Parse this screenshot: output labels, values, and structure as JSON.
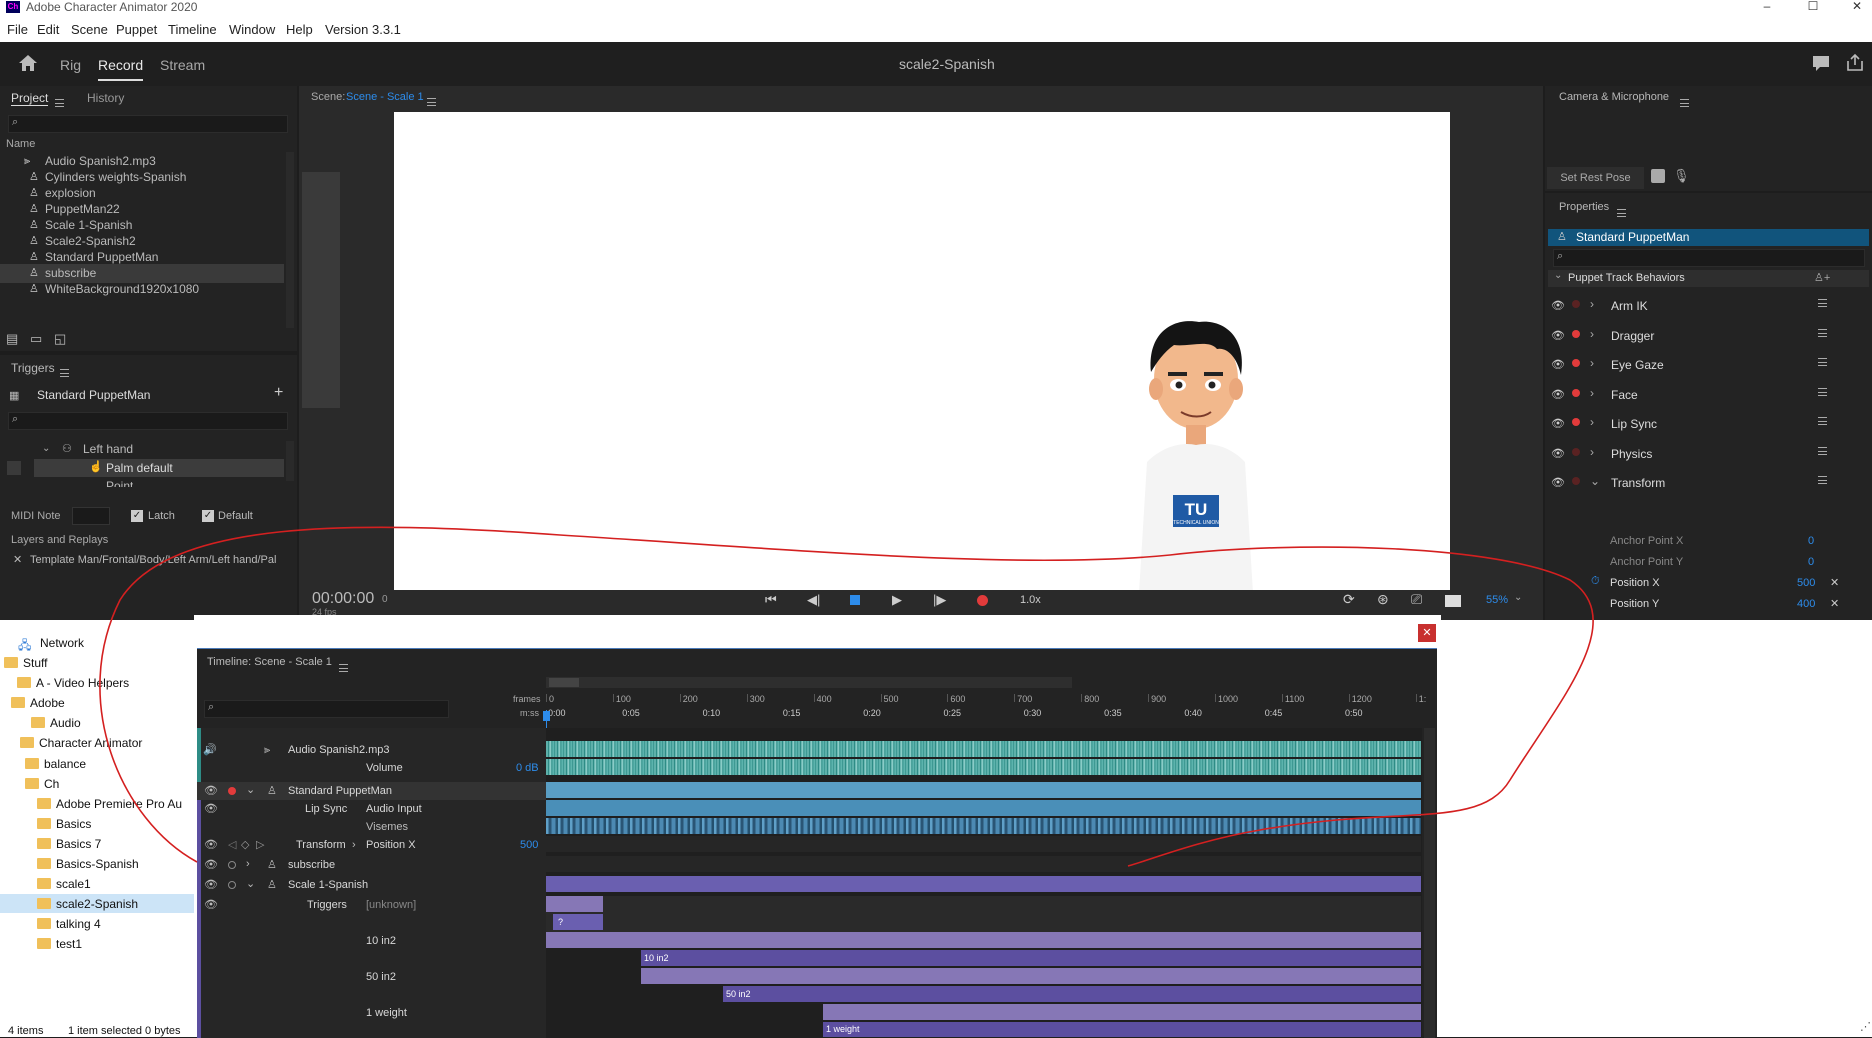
{
  "window": {
    "title": "Adobe Character Animator 2020",
    "logo_text": "Ch"
  },
  "menu": [
    "File",
    "Edit",
    "Scene",
    "Puppet",
    "Timeline",
    "Window",
    "Help",
    "Version 3.3.1"
  ],
  "appbar": {
    "tabs": [
      "Rig",
      "Record",
      "Stream"
    ],
    "active_tab": "Record",
    "doc_title": "scale2-Spanish"
  },
  "project": {
    "tabs": [
      "Project",
      "History"
    ],
    "col_header": "Name",
    "items": [
      {
        "icon": "audio-icon",
        "name": "Audio Spanish2.mp3"
      },
      {
        "icon": "puppet-icon",
        "name": "Cylinders weights-Spanish"
      },
      {
        "icon": "puppet-icon",
        "name": "explosion"
      },
      {
        "icon": "puppet-icon",
        "name": "PuppetMan22"
      },
      {
        "icon": "puppet-icon",
        "name": "Scale 1-Spanish"
      },
      {
        "icon": "puppet-icon",
        "name": "Scale2-Spanish2"
      },
      {
        "icon": "puppet-icon",
        "name": "Standard PuppetMan"
      },
      {
        "icon": "puppet-icon",
        "name": "subscribe"
      },
      {
        "icon": "puppet-icon",
        "name": "WhiteBackground1920x1080"
      }
    ],
    "selected_index": 7
  },
  "triggers": {
    "title": "Triggers",
    "puppet": "Standard PuppetMan",
    "tree": [
      "Left hand",
      "Palm default",
      "Point"
    ],
    "midi_label": "MIDI Note",
    "latch_label": "Latch",
    "default_label": "Default",
    "layers_label": "Layers and Replays",
    "layer_path": "Template Man/Frontal/Body/Left Arm/Left hand/Pal"
  },
  "scene": {
    "label": "Scene:",
    "name": "Scene - Scale 1",
    "timecode": "00:00:00",
    "frame": "0",
    "fps": "24 fps",
    "speed": "1.0x",
    "zoom": "55%",
    "shirt_text": "TU",
    "shirt_sub": "TECHNICAL UNION"
  },
  "camera": {
    "title": "Camera & Microphone",
    "rest_pose": "Set Rest Pose"
  },
  "properties": {
    "title": "Properties",
    "selected": "Standard PuppetMan",
    "section": "Puppet Track Behaviors",
    "behaviors": [
      {
        "name": "Arm IK",
        "armed": false
      },
      {
        "name": "Dragger",
        "armed": true
      },
      {
        "name": "Eye Gaze",
        "armed": true
      },
      {
        "name": "Face",
        "armed": true
      },
      {
        "name": "Lip Sync",
        "armed": true
      },
      {
        "name": "Physics",
        "armed": false
      },
      {
        "name": "Transform",
        "armed": false
      }
    ],
    "params": [
      {
        "name": "Anchor Point X",
        "value": "0"
      },
      {
        "name": "Anchor Point Y",
        "value": "0"
      },
      {
        "name": "Position X",
        "value": "500"
      },
      {
        "name": "Position Y",
        "value": "400"
      }
    ]
  },
  "explorer": {
    "network": "Network",
    "folders": [
      "Stuff",
      "A - Video Helpers",
      "Adobe",
      "Audio",
      "Character Animator",
      "balance",
      "Ch",
      "Adobe Premiere Pro Au",
      "Basics",
      "Basics 7",
      "Basics-Spanish",
      "scale1",
      "scale2-Spanish",
      "talking 4",
      "test1"
    ],
    "selected": "scale2-Spanish",
    "status_items": "4 items",
    "status_sel": "1 item selected  0 bytes"
  },
  "timeline": {
    "title": "Timeline: Scene - Scale 1",
    "frames_label": "frames",
    "mss_label": "m:ss",
    "frame_ticks": [
      "0",
      "100",
      "200",
      "300",
      "400",
      "500",
      "600",
      "700",
      "800",
      "900",
      "1000",
      "1100",
      "1200",
      "1:"
    ],
    "time_ticks": [
      "0:00",
      "0:05",
      "0:10",
      "0:15",
      "0:20",
      "0:25",
      "0:30",
      "0:35",
      "0:40",
      "0:45",
      "0:50"
    ],
    "rows": {
      "audio": "Audio Spanish2.mp3",
      "volume": "Volume",
      "volume_val": "0 dB",
      "puppet": "Standard PuppetMan",
      "lipsync": "Lip Sync",
      "audio_input": "Audio Input",
      "visemes": "Visemes",
      "transform": "Transform",
      "posx": "Position X",
      "posx_val": "500",
      "subscribe": "subscribe",
      "scale1": "Scale 1-Spanish",
      "triggers": "Triggers",
      "unknown": "[unknown]",
      "t1": "10 in2",
      "t2": "50 in2",
      "t3": "1 weight",
      "clip_q": "?",
      "clip1": "10 in2",
      "clip2": "50 in2",
      "clip3": "1 weight"
    }
  },
  "colors": {
    "accent": "#2d8ceb",
    "record": "#e23b3b",
    "selected_bg": "#11547c",
    "annotation": "#d42020"
  }
}
